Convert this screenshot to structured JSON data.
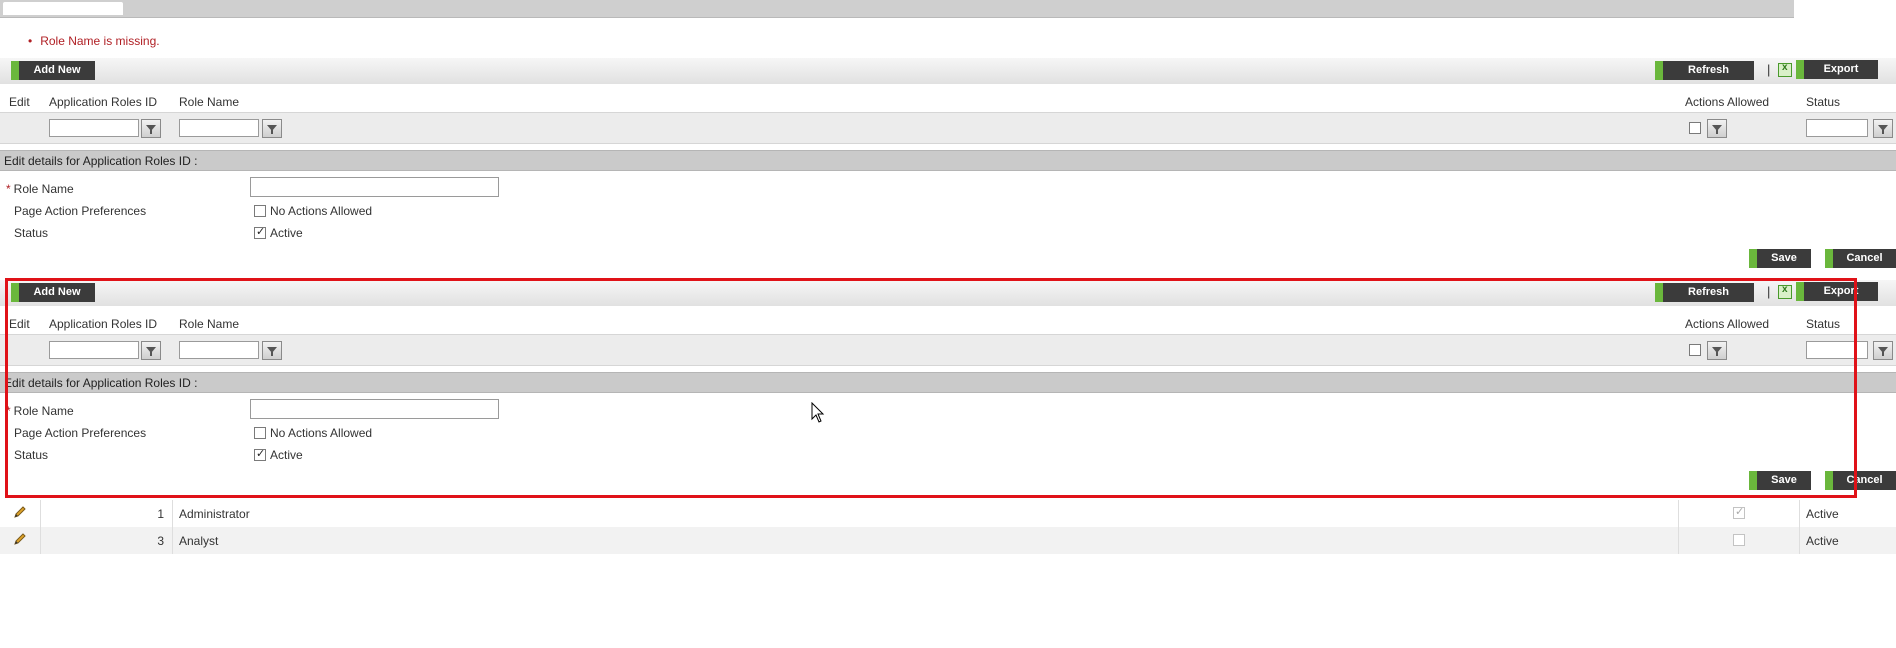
{
  "validation": {
    "bullet": "•",
    "message": "Role Name is missing."
  },
  "toolbar": {
    "add_new": "Add New",
    "refresh": "Refresh",
    "separator": "|",
    "export": "Export",
    "export_icon": "excel-icon"
  },
  "grid": {
    "columns": {
      "edit": "Edit",
      "app_roles_id": "Application Roles ID",
      "role_name": "Role Name",
      "actions_allowed": "Actions Allowed",
      "status": "Status"
    },
    "filter_icon": "filter-icon"
  },
  "form": {
    "edit_header": "Edit details for Application Roles ID :",
    "required_mark": "*",
    "role_name_label": "Role Name",
    "role_name_value": "",
    "page_action_label": "Page Action Preferences",
    "no_actions_label": "No Actions Allowed",
    "no_actions_checked": false,
    "status_label": "Status",
    "active_label": "Active",
    "active_checked": true,
    "save": "Save",
    "cancel": "Cancel"
  },
  "rows": [
    {
      "id": "1",
      "role_name": "Administrator",
      "actions_allowed": true,
      "status": "Active"
    },
    {
      "id": "3",
      "role_name": "Analyst",
      "actions_allowed": false,
      "status": "Active"
    }
  ],
  "colors": {
    "accent_green": "#6ab73c",
    "button_dark": "#3b3b3b",
    "error_red": "#b01f24",
    "highlight_box": "#e01218"
  }
}
